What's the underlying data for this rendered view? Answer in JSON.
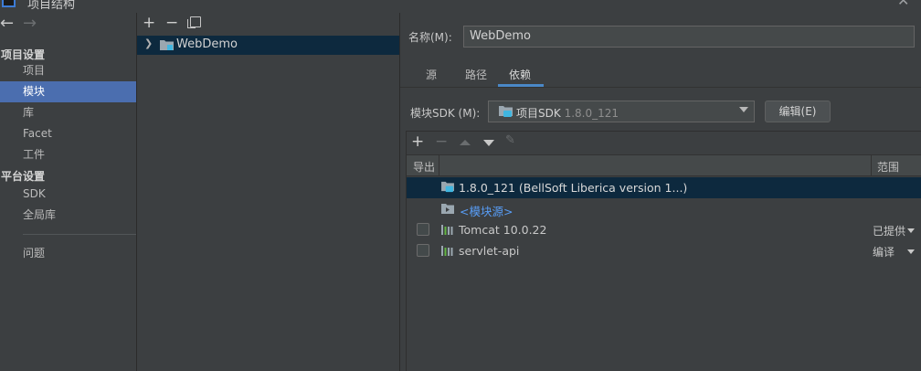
{
  "window": {
    "title": "项目结构"
  },
  "nav": {
    "project_settings_heading": "项目设置",
    "project_items": [
      "项目",
      "模块",
      "库",
      "Facet",
      "工件"
    ],
    "platform_settings_heading": "平台设置",
    "platform_items": [
      "SDK",
      "全局库"
    ],
    "problems_label": "问题",
    "selected": "模块"
  },
  "tree": {
    "module_name": "WebDemo"
  },
  "module": {
    "name_label": "名称(M):",
    "name_value": "WebDemo",
    "tabs": [
      "源",
      "路径",
      "依赖"
    ],
    "active_tab": "依赖",
    "sdk_label": "模块SDK (M):",
    "sdk_name": "项目SDK",
    "sdk_version": "1.8.0_121",
    "edit_button": "编辑(E)"
  },
  "dependencies": {
    "header_export": "导出",
    "header_scope": "范围",
    "rows": [
      {
        "name": "1.8.0_121 (BellSoft Liberica version 1...)",
        "type": "sdk",
        "selected": true
      },
      {
        "name": "<模块源>",
        "type": "module-source"
      },
      {
        "name": "Tomcat 10.0.22",
        "type": "library",
        "exported": false,
        "scope": "已提供"
      },
      {
        "name": "servlet-api",
        "type": "library",
        "exported": false,
        "scope": "编译"
      }
    ]
  },
  "colors": {
    "background": "#3c3f41",
    "selection": "#4b6eaf",
    "tree_selection": "#0d293e",
    "link": "#589df6",
    "tab_underline": "#4a88c7"
  }
}
